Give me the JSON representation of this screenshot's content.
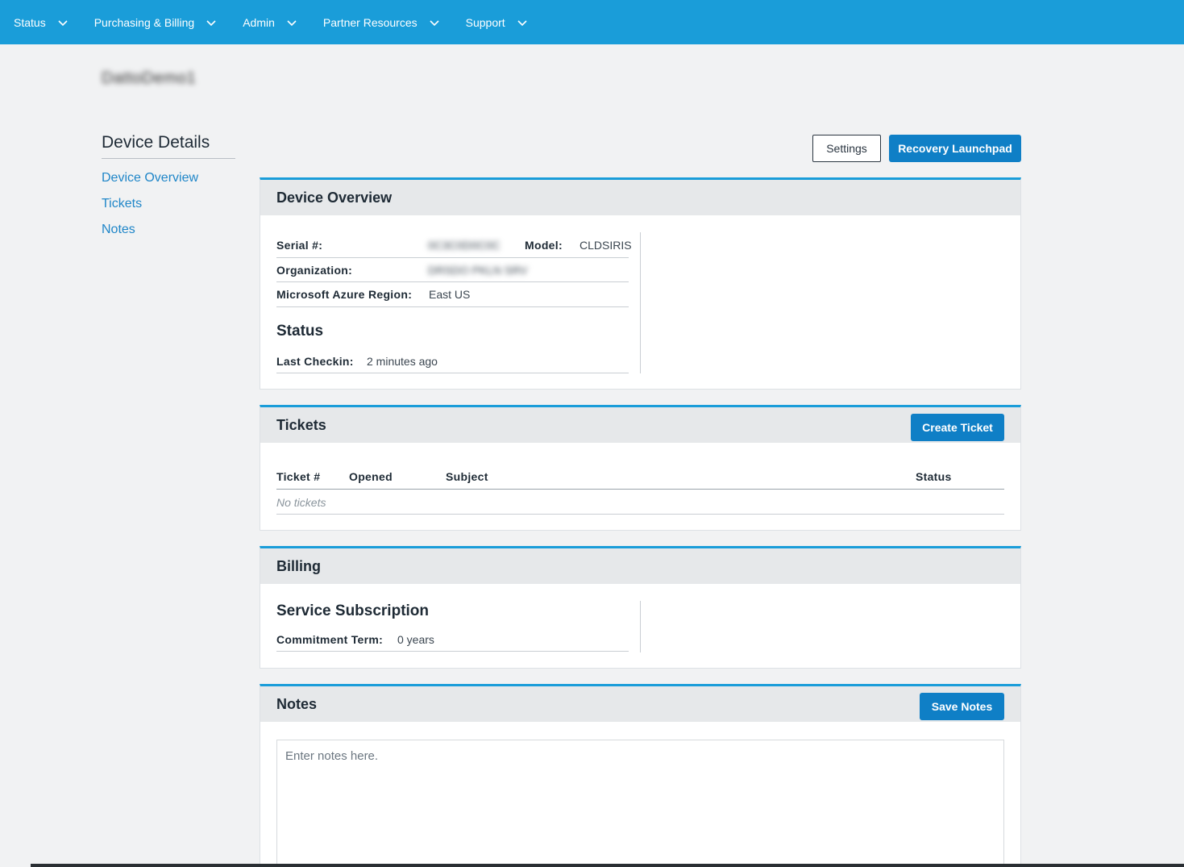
{
  "nav": {
    "items": [
      {
        "label": "Status"
      },
      {
        "label": "Purchasing & Billing"
      },
      {
        "label": "Admin"
      },
      {
        "label": "Partner Resources"
      },
      {
        "label": "Support"
      }
    ]
  },
  "page": {
    "device_name": "DattoDemo1"
  },
  "sidebar": {
    "title": "Device Details",
    "links": [
      "Device Overview",
      "Tickets",
      "Notes"
    ]
  },
  "actions": {
    "settings_label": "Settings",
    "recovery_label": "Recovery Launchpad"
  },
  "overview": {
    "title": "Device Overview",
    "serial_label": "Serial #:",
    "serial_value": "0C3C0D0C0C",
    "model_label": "Model:",
    "model_value": "CLDSIRIS",
    "org_label": "Organization:",
    "org_value": "DRSDO PKLN SRV",
    "region_label": "Microsoft Azure Region:",
    "region_value": "East US",
    "status_heading": "Status",
    "checkin_label": "Last Checkin:",
    "checkin_value": "2 minutes ago"
  },
  "tickets": {
    "title": "Tickets",
    "create_label": "Create Ticket",
    "columns": [
      "Ticket #",
      "Opened",
      "Subject",
      "Status"
    ],
    "empty_text": "No tickets"
  },
  "billing": {
    "title": "Billing",
    "subscription_heading": "Service Subscription",
    "term_label": "Commitment Term:",
    "term_value": "0 years"
  },
  "notes": {
    "title": "Notes",
    "save_label": "Save Notes",
    "placeholder": "Enter notes here."
  },
  "colors": {
    "nav": "#1a9dd9",
    "primary_button": "#0f7fc6",
    "link": "#1f86c8"
  }
}
